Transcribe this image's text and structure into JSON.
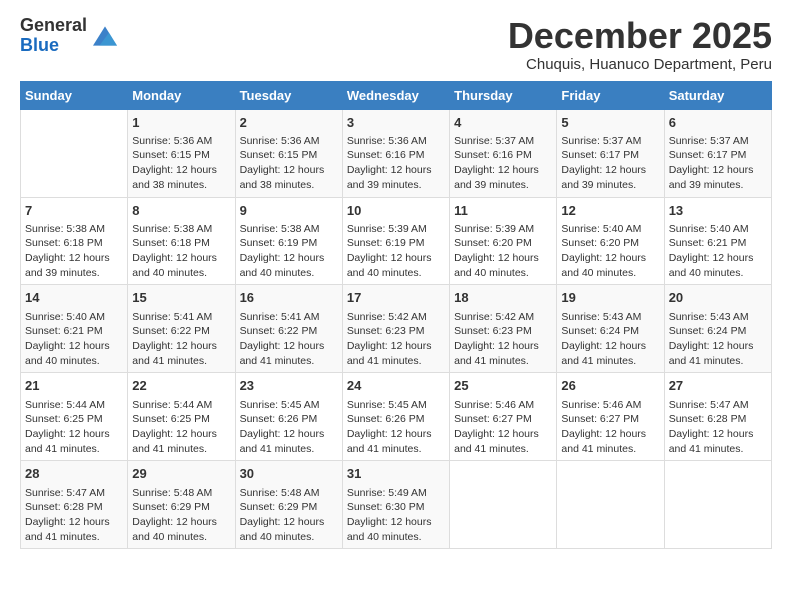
{
  "logo": {
    "general": "General",
    "blue": "Blue"
  },
  "title": "December 2025",
  "subtitle": "Chuquis, Huanuco Department, Peru",
  "days_of_week": [
    "Sunday",
    "Monday",
    "Tuesday",
    "Wednesday",
    "Thursday",
    "Friday",
    "Saturday"
  ],
  "weeks": [
    [
      {
        "day": "",
        "info": ""
      },
      {
        "day": "1",
        "info": "Sunrise: 5:36 AM\nSunset: 6:15 PM\nDaylight: 12 hours\nand 38 minutes."
      },
      {
        "day": "2",
        "info": "Sunrise: 5:36 AM\nSunset: 6:15 PM\nDaylight: 12 hours\nand 38 minutes."
      },
      {
        "day": "3",
        "info": "Sunrise: 5:36 AM\nSunset: 6:16 PM\nDaylight: 12 hours\nand 39 minutes."
      },
      {
        "day": "4",
        "info": "Sunrise: 5:37 AM\nSunset: 6:16 PM\nDaylight: 12 hours\nand 39 minutes."
      },
      {
        "day": "5",
        "info": "Sunrise: 5:37 AM\nSunset: 6:17 PM\nDaylight: 12 hours\nand 39 minutes."
      },
      {
        "day": "6",
        "info": "Sunrise: 5:37 AM\nSunset: 6:17 PM\nDaylight: 12 hours\nand 39 minutes."
      }
    ],
    [
      {
        "day": "7",
        "info": "Sunrise: 5:38 AM\nSunset: 6:18 PM\nDaylight: 12 hours\nand 39 minutes."
      },
      {
        "day": "8",
        "info": "Sunrise: 5:38 AM\nSunset: 6:18 PM\nDaylight: 12 hours\nand 40 minutes."
      },
      {
        "day": "9",
        "info": "Sunrise: 5:38 AM\nSunset: 6:19 PM\nDaylight: 12 hours\nand 40 minutes."
      },
      {
        "day": "10",
        "info": "Sunrise: 5:39 AM\nSunset: 6:19 PM\nDaylight: 12 hours\nand 40 minutes."
      },
      {
        "day": "11",
        "info": "Sunrise: 5:39 AM\nSunset: 6:20 PM\nDaylight: 12 hours\nand 40 minutes."
      },
      {
        "day": "12",
        "info": "Sunrise: 5:40 AM\nSunset: 6:20 PM\nDaylight: 12 hours\nand 40 minutes."
      },
      {
        "day": "13",
        "info": "Sunrise: 5:40 AM\nSunset: 6:21 PM\nDaylight: 12 hours\nand 40 minutes."
      }
    ],
    [
      {
        "day": "14",
        "info": "Sunrise: 5:40 AM\nSunset: 6:21 PM\nDaylight: 12 hours\nand 40 minutes."
      },
      {
        "day": "15",
        "info": "Sunrise: 5:41 AM\nSunset: 6:22 PM\nDaylight: 12 hours\nand 41 minutes."
      },
      {
        "day": "16",
        "info": "Sunrise: 5:41 AM\nSunset: 6:22 PM\nDaylight: 12 hours\nand 41 minutes."
      },
      {
        "day": "17",
        "info": "Sunrise: 5:42 AM\nSunset: 6:23 PM\nDaylight: 12 hours\nand 41 minutes."
      },
      {
        "day": "18",
        "info": "Sunrise: 5:42 AM\nSunset: 6:23 PM\nDaylight: 12 hours\nand 41 minutes."
      },
      {
        "day": "19",
        "info": "Sunrise: 5:43 AM\nSunset: 6:24 PM\nDaylight: 12 hours\nand 41 minutes."
      },
      {
        "day": "20",
        "info": "Sunrise: 5:43 AM\nSunset: 6:24 PM\nDaylight: 12 hours\nand 41 minutes."
      }
    ],
    [
      {
        "day": "21",
        "info": "Sunrise: 5:44 AM\nSunset: 6:25 PM\nDaylight: 12 hours\nand 41 minutes."
      },
      {
        "day": "22",
        "info": "Sunrise: 5:44 AM\nSunset: 6:25 PM\nDaylight: 12 hours\nand 41 minutes."
      },
      {
        "day": "23",
        "info": "Sunrise: 5:45 AM\nSunset: 6:26 PM\nDaylight: 12 hours\nand 41 minutes."
      },
      {
        "day": "24",
        "info": "Sunrise: 5:45 AM\nSunset: 6:26 PM\nDaylight: 12 hours\nand 41 minutes."
      },
      {
        "day": "25",
        "info": "Sunrise: 5:46 AM\nSunset: 6:27 PM\nDaylight: 12 hours\nand 41 minutes."
      },
      {
        "day": "26",
        "info": "Sunrise: 5:46 AM\nSunset: 6:27 PM\nDaylight: 12 hours\nand 41 minutes."
      },
      {
        "day": "27",
        "info": "Sunrise: 5:47 AM\nSunset: 6:28 PM\nDaylight: 12 hours\nand 41 minutes."
      }
    ],
    [
      {
        "day": "28",
        "info": "Sunrise: 5:47 AM\nSunset: 6:28 PM\nDaylight: 12 hours\nand 41 minutes."
      },
      {
        "day": "29",
        "info": "Sunrise: 5:48 AM\nSunset: 6:29 PM\nDaylight: 12 hours\nand 40 minutes."
      },
      {
        "day": "30",
        "info": "Sunrise: 5:48 AM\nSunset: 6:29 PM\nDaylight: 12 hours\nand 40 minutes."
      },
      {
        "day": "31",
        "info": "Sunrise: 5:49 AM\nSunset: 6:30 PM\nDaylight: 12 hours\nand 40 minutes."
      },
      {
        "day": "",
        "info": ""
      },
      {
        "day": "",
        "info": ""
      },
      {
        "day": "",
        "info": ""
      }
    ]
  ]
}
